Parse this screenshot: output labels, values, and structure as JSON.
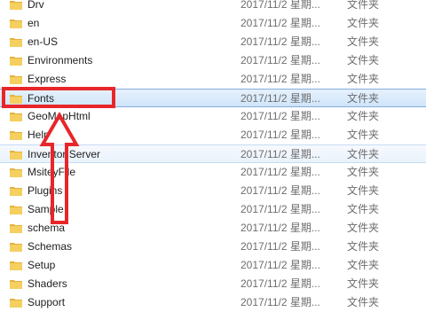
{
  "files": [
    {
      "name": "Drv",
      "modified": "2017/11/2 星期...",
      "type": "文件夹"
    },
    {
      "name": "en",
      "modified": "2017/11/2 星期...",
      "type": "文件夹"
    },
    {
      "name": "en-US",
      "modified": "2017/11/2 星期...",
      "type": "文件夹"
    },
    {
      "name": "Environments",
      "modified": "2017/11/2 星期...",
      "type": "文件夹"
    },
    {
      "name": "Express",
      "modified": "2017/11/2 星期...",
      "type": "文件夹"
    },
    {
      "name": "Fonts",
      "modified": "2017/11/2 星期...",
      "type": "文件夹"
    },
    {
      "name": "GeoMapHtml",
      "modified": "2017/11/2 星期...",
      "type": "文件夹"
    },
    {
      "name": "Help",
      "modified": "2017/11/2 星期...",
      "type": "文件夹"
    },
    {
      "name": "Inventor Server",
      "modified": "2017/11/2 星期...",
      "type": "文件夹"
    },
    {
      "name": "MsiteyFile",
      "modified": "2017/11/2 星期...",
      "type": "文件夹"
    },
    {
      "name": "Plugins",
      "modified": "2017/11/2 星期...",
      "type": "文件夹"
    },
    {
      "name": "Sample",
      "modified": "2017/11/2 星期...",
      "type": "文件夹"
    },
    {
      "name": "schema",
      "modified": "2017/11/2 星期...",
      "type": "文件夹"
    },
    {
      "name": "Schemas",
      "modified": "2017/11/2 星期...",
      "type": "文件夹"
    },
    {
      "name": "Setup",
      "modified": "2017/11/2 星期...",
      "type": "文件夹"
    },
    {
      "name": "Shaders",
      "modified": "2017/11/2 星期...",
      "type": "文件夹"
    },
    {
      "name": "Support",
      "modified": "2017/11/2 星期...",
      "type": "文件夹"
    }
  ],
  "selected_folder": "Fonts",
  "hovered_folder": "Inventor Server",
  "annotation": {
    "color": "#e8262a",
    "shape": "up-arrow-and-box"
  },
  "icons": {
    "folder": "folder-icon"
  }
}
